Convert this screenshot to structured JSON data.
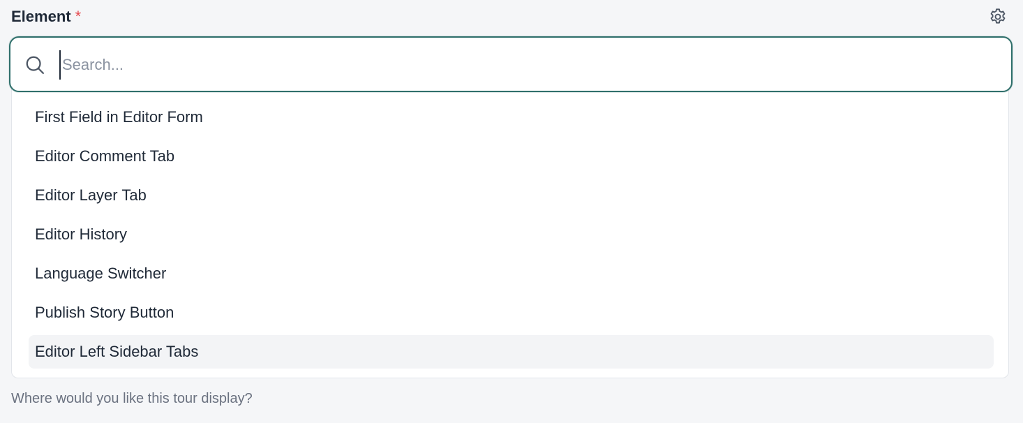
{
  "field": {
    "label": "Element",
    "required_marker": "*",
    "help_text": "Where would you like this tour display?"
  },
  "search": {
    "placeholder": "Search...",
    "value": ""
  },
  "options": [
    {
      "label": "First Field in Editor Form"
    },
    {
      "label": "Editor Comment Tab"
    },
    {
      "label": "Editor Layer Tab"
    },
    {
      "label": "Editor History"
    },
    {
      "label": "Language Switcher"
    },
    {
      "label": "Publish Story Button"
    },
    {
      "label": "Editor Left Sidebar Tabs",
      "highlighted": true
    }
  ],
  "icons": {
    "settings": "gear-icon",
    "search": "search-icon"
  },
  "colors": {
    "focus_border": "#2f6f6b",
    "required": "#e5484d",
    "highlight": "#f3f4f6",
    "background": "#f5f6f8"
  }
}
